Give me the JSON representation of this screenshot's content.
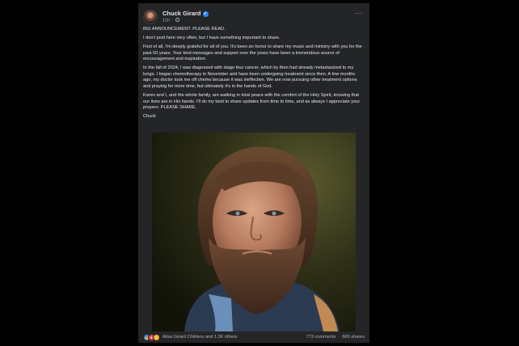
{
  "post": {
    "author": "Chuck Girard",
    "time": "11h",
    "more_icon": "···",
    "paragraphs": [
      "BIG ANNOUNCEMENT. PLEASE READ.",
      "I don't post here very often, but I have something important to share.",
      "First of all, I'm deeply grateful for all of you.  It's been an honor to share my music and ministry with you for the past 50 years. Your kind messages and support over the years have been a tremendous source of encouragement and inspiration.",
      "In the fall of 2024, I was diagnosed with stage four cancer, which by then had already metastasized to my lungs. I began chemotherapy in November and have been undergoing treatment since then. A few months ago, my doctor took me off chemo because it was ineffective. We are now pursuing other treatment options and praying for more time, but ultimately it's in the hands of God.",
      "Karen and I, and the whole family, are walking in total peace with the comfort of the Holy Spirit, knowing that our lives are in His hands. I'll do my best to share updates from time to time, and as always I appreciate your prayers. PLEASE SHARE.",
      "Chuck"
    ]
  },
  "reactions": {
    "icons": [
      "like-icon",
      "love-icon",
      "care-icon"
    ],
    "colors": [
      "#2d88ff",
      "#f33e58",
      "#f7b125"
    ],
    "names": "Alisa Girard Childers and 1.3K others",
    "comments": "773 comments",
    "shares": "665 shares"
  }
}
